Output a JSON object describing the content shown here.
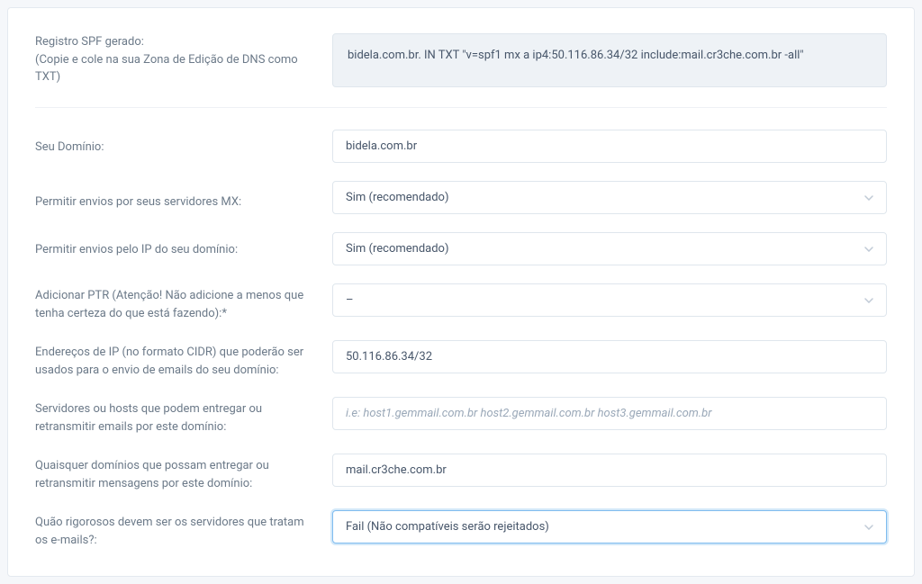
{
  "spf_output": {
    "label_line1": "Registro SPF gerado:",
    "label_line2": "(Copie e cole na sua Zona de Edição de DNS como TXT)",
    "value": "bidela.com.br.  IN TXT \"v=spf1 mx a ip4:50.116.86.34/32 include:mail.cr3che.com.br -all\""
  },
  "domain": {
    "label": "Seu Domínio:",
    "value": "bidela.com.br"
  },
  "allow_mx": {
    "label": "Permitir envios por seus servidores MX:",
    "selected": "Sim (recomendado)"
  },
  "allow_domain_ip": {
    "label": "Permitir envios pelo IP do seu domínio:",
    "selected": "Sim (recomendado)"
  },
  "ptr": {
    "label": "Adicionar PTR (Atenção! Não adicione a menos que tenha certeza do que está fazendo):*",
    "selected": "–"
  },
  "cidr": {
    "label": "Endereços de IP (no formato CIDR) que poderão ser usados para o envio de emails do seu domínio:",
    "value": "50.116.86.34/32"
  },
  "hosts": {
    "label": "Servidores ou hosts que podem entregar ou retransmitir emails por este domínio:",
    "placeholder": "i.e: host1.gemmail.com.br host2.gemmail.com.br host3.gemmail.com.br",
    "value": ""
  },
  "include_domains": {
    "label": "Quaisquer domínios que possam entregar ou retransmitir mensagens por este domínio:",
    "value": "mail.cr3che.com.br"
  },
  "strictness": {
    "label": "Quão rigorosos devem ser os servidores que tratam os e-mails?:",
    "selected": "Fail (Não compatíveis serão rejeitados)"
  }
}
